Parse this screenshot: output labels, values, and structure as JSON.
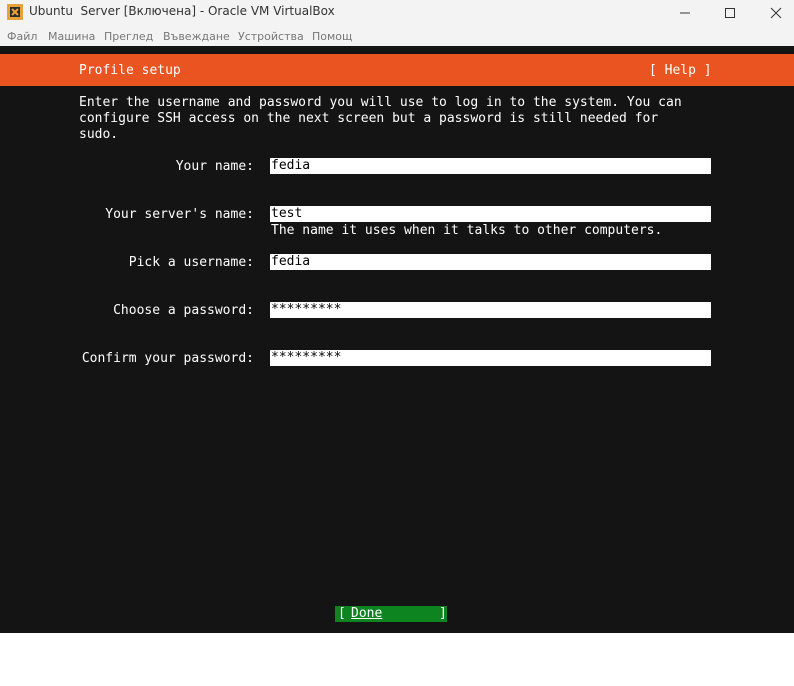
{
  "window": {
    "title": "Ubuntu  Server [Включена] - Oracle VM VirtualBox",
    "icon": "virtualbox-icon",
    "controls": [
      "minimize-icon",
      "maximize-icon",
      "close-icon"
    ]
  },
  "menubar": {
    "items": [
      "Файл",
      "Машина",
      "Преглед",
      "Въвеждане",
      "Устройства",
      "Помощ"
    ]
  },
  "installer": {
    "header": {
      "title": "Profile setup",
      "help_label": "[ Help ]",
      "color": "#e95420"
    },
    "intro_lines": [
      "Enter the username and password you will use to log in to the system. You can",
      "configure SSH access on the next screen but a password is still needed for",
      "sudo."
    ],
    "fields": [
      {
        "label": "Your name:",
        "value": "fedia"
      },
      {
        "label": "Your server's name:",
        "value": "test",
        "hint": "The name it uses when it talks to other computers."
      },
      {
        "label": "Pick a username:",
        "value": "fedia"
      },
      {
        "label": "Choose a password:",
        "value": "*********"
      },
      {
        "label": "Confirm your password:",
        "value": "*********"
      }
    ],
    "done_button": {
      "bracket_left": "[",
      "label": "Done",
      "bracket_right": "]",
      "color": "#0e8420"
    },
    "background": "#141414"
  }
}
